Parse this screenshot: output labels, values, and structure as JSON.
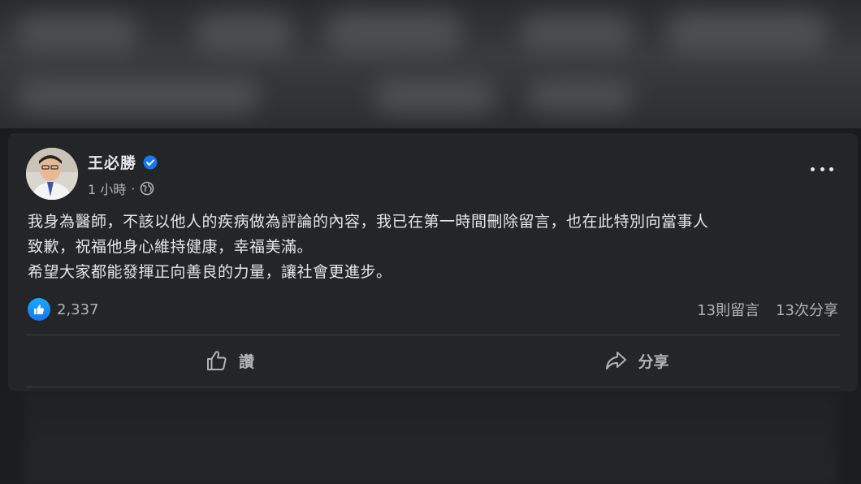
{
  "post": {
    "author": "王必勝",
    "time": "1 小時",
    "separator": "·",
    "text_lines": [
      "我身為醫師，不該以他人的疾病做為評論的內容，我已在第一時間刪除留言，也在此特別向當事人",
      "致歉，祝福他身心維持健康，幸福美滿。",
      "希望大家都能發揮正向善良的力量，讓社會更進步。"
    ],
    "reaction_count": "2,337",
    "comments": "13則留言",
    "shares": "13次分享"
  },
  "actions": {
    "like_label": "讚",
    "share_label": "分享"
  },
  "colors": {
    "card_bg": "#242526",
    "text_primary": "#e4e6eb",
    "text_secondary": "#b0b3b8",
    "accent_blue": "#1877f2"
  }
}
